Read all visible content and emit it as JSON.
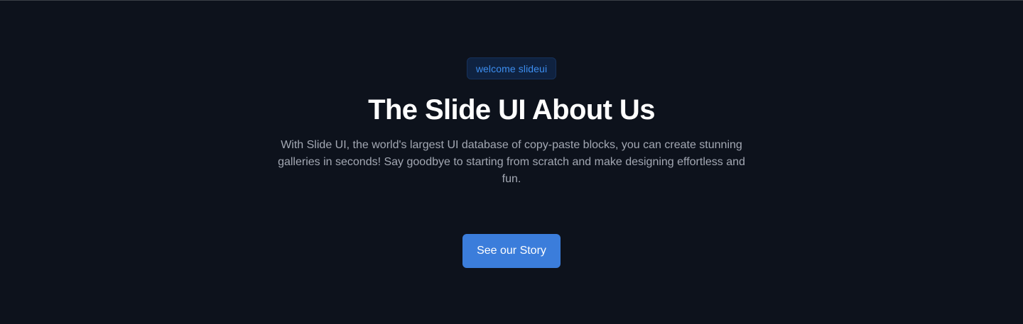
{
  "hero": {
    "badge": "welcome slideui",
    "title": "The Slide UI About Us",
    "description": "With Slide UI, the world's largest UI database of copy-paste blocks, you can create stunning galleries in seconds! Say goodbye to starting from scratch and make designing effortless and fun.",
    "cta_label": "See our Story"
  },
  "colors": {
    "background": "#0d121c",
    "badge_background": "#0f2240",
    "badge_text": "#3d8ef0",
    "title_text": "#ffffff",
    "description_text": "#a3a8b3",
    "cta_background": "#3b7ddb",
    "cta_text": "#ffffff"
  }
}
